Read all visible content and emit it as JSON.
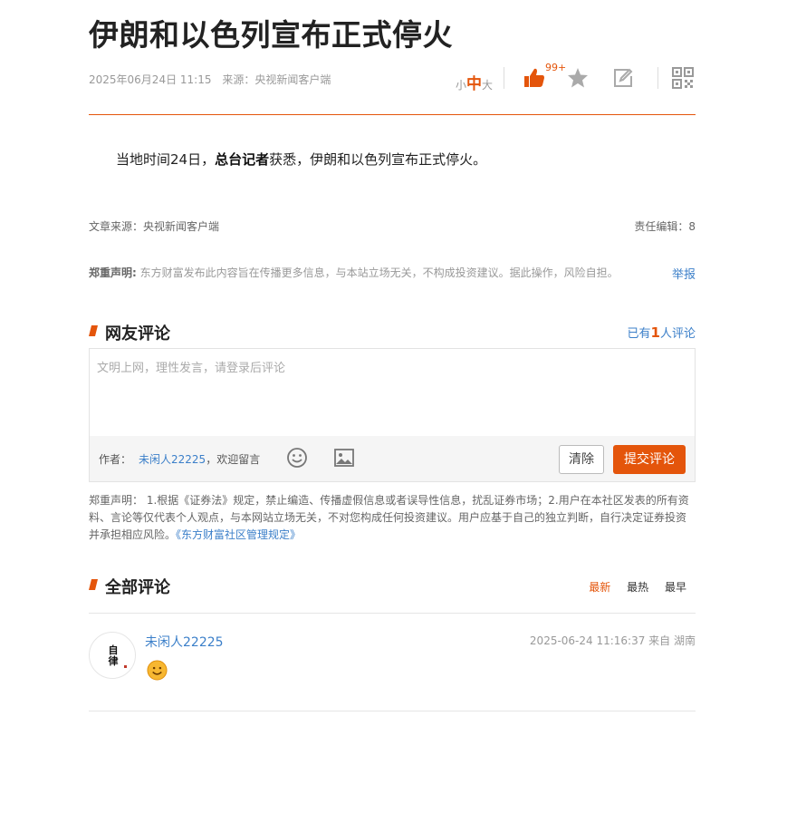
{
  "article": {
    "title": "伊朗和以色列宣布正式停火",
    "date": "2025年06月24日 11:15",
    "source": "来源：央视新闻客户端",
    "body_prefix": "当地时间24日，",
    "body_bold": "总台记者",
    "body_suffix": "获悉，伊朗和以色列宣布正式停火。"
  },
  "toolbar": {
    "font_small": "小",
    "font_medium": "中",
    "font_large": "大",
    "like_count": "99+",
    "icons": [
      "thumbs-up-icon",
      "star-icon",
      "edit-icon",
      "qrcode-icon"
    ]
  },
  "source_row": {
    "source": "文章来源：央视新闻客户端",
    "editor": "责任编辑：8"
  },
  "disclaimer1": {
    "label": "郑重声明:",
    "text": " 东方财富发布此内容旨在传播更多信息，与本站立场无关，不构成投资建议。据此操作，风险自担。",
    "report": "举报"
  },
  "comments_section": {
    "title": "网友评论",
    "count_prefix": "已有",
    "count": "1",
    "count_suffix": "人评论",
    "placeholder": "文明上网，理性发言，请登录后评论",
    "author_label": "作者：",
    "author_name": "未闲人22225",
    "author_suffix": "，欢迎留言",
    "clear": "清除",
    "submit": "提交评论"
  },
  "disclaimer2": {
    "text": "郑重声明： 1.根据《证券法》规定，禁止编造、传播虚假信息或者误导性信息，扰乱证券市场；2.用户在本社区发表的所有资料、言论等仅代表个人观点，与本网站立场无关，不对您构成任何投资建议。用户应基于自己的独立判断，自行决定证券投资并承担相应风险。",
    "link": "《东方财富社区管理规定》"
  },
  "all_comments": {
    "title": "全部评论",
    "tabs": [
      "最新",
      "最热",
      "最早"
    ],
    "items": [
      {
        "user": "未闲人22225",
        "time": "2025-06-24 11:16:37 来自 湖南",
        "avatar_text": "自律",
        "content_icon": "smile-emoji-icon"
      }
    ]
  },
  "colors": {
    "accent": "#e4550b",
    "link": "#3b7fc9"
  }
}
